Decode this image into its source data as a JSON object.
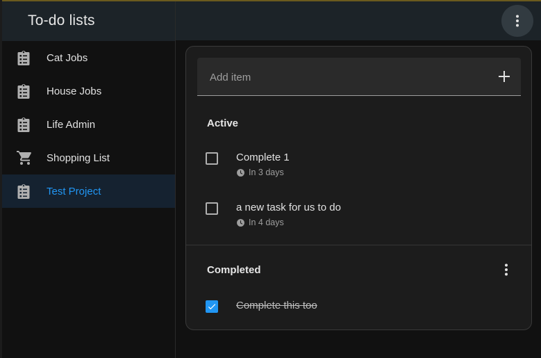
{
  "sidebar": {
    "title": "To-do lists",
    "items": [
      {
        "label": "Cat Jobs",
        "icon": "clipboard-list-icon",
        "selected": false
      },
      {
        "label": "House Jobs",
        "icon": "clipboard-list-icon",
        "selected": false
      },
      {
        "label": "Life Admin",
        "icon": "clipboard-list-icon",
        "selected": false
      },
      {
        "label": "Shopping List",
        "icon": "cart-icon",
        "selected": false
      },
      {
        "label": "Test Project",
        "icon": "clipboard-list-icon",
        "selected": true
      }
    ]
  },
  "topbar": {
    "menu_icon": "dots-vertical-icon"
  },
  "add_item": {
    "placeholder": "Add item",
    "add_icon": "plus-icon"
  },
  "active": {
    "title": "Active",
    "tasks": [
      {
        "title": "Complete 1",
        "due": "In 3 days",
        "checked": false
      },
      {
        "title": "a new task for us to do",
        "due": "In 4 days",
        "checked": false
      }
    ]
  },
  "completed": {
    "title": "Completed",
    "menu_icon": "dots-vertical-icon",
    "tasks": [
      {
        "title": "Complete this too",
        "checked": true
      }
    ]
  },
  "colors": {
    "accent": "#2196f3",
    "header_bg": "#1c2328",
    "selected_bg": "#152230",
    "card_bg": "#1c1c1c"
  }
}
